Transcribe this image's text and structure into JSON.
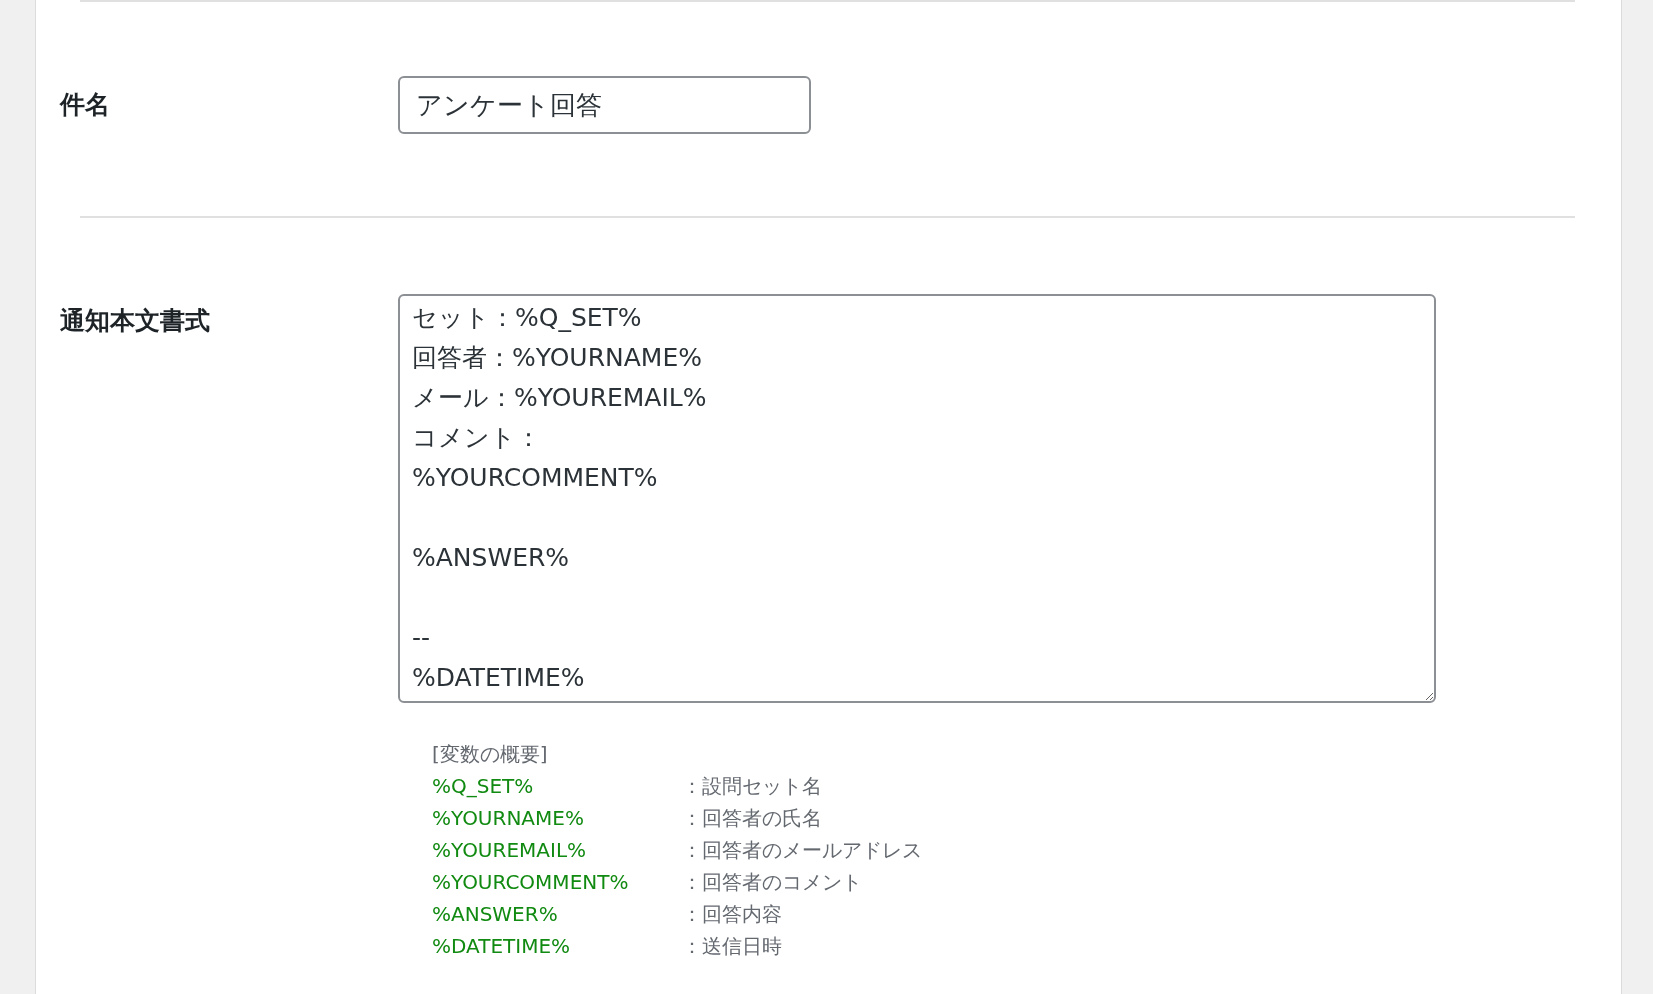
{
  "fields": [
    {
      "kind": "input",
      "label": "件名",
      "value": "アンケート回答"
    },
    {
      "kind": "textarea",
      "label": "通知本文書式",
      "value": "セット：%Q_SET%\n回答者：%YOURNAME%\nメール：%YOUREMAIL%\nコメント：\n%YOURCOMMENT%\n\n%ANSWER%\n\n--\n%DATETIME%",
      "legend": {
        "title": "[変数の概要]",
        "variables": [
          {
            "name": "%Q_SET%",
            "description": "：設問セット名"
          },
          {
            "name": "%YOURNAME%",
            "description": "：回答者の氏名"
          },
          {
            "name": "%YOUREMAIL%",
            "description": "：回答者のメールアドレス"
          },
          {
            "name": "%YOURCOMMENT%",
            "description": "：回答者のコメント"
          },
          {
            "name": "%ANSWER%",
            "description": "：回答内容"
          },
          {
            "name": "%DATETIME%",
            "description": "：送信日時"
          }
        ]
      }
    }
  ]
}
